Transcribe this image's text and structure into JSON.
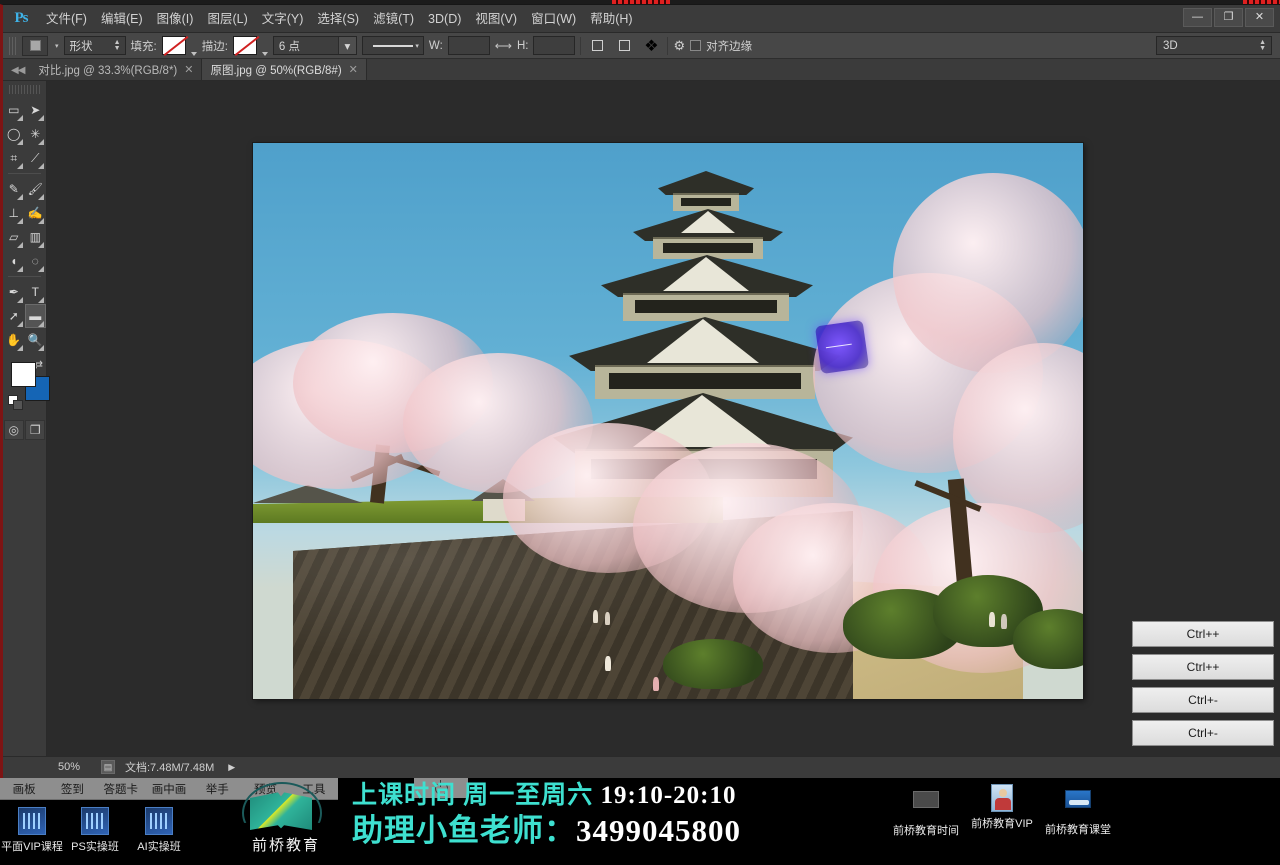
{
  "app": {
    "logo": "Ps",
    "title": "Adobe Photoshop"
  },
  "menubar": {
    "items": [
      "文件(F)",
      "编辑(E)",
      "图像(I)",
      "图层(L)",
      "文字(Y)",
      "选择(S)",
      "滤镜(T)",
      "3D(D)",
      "视图(V)",
      "窗口(W)",
      "帮助(H)"
    ]
  },
  "window_controls": {
    "minimize": "—",
    "maximize": "❐",
    "close": "✕"
  },
  "options_bar": {
    "tool_preset_icon": "shape-tool-icon",
    "mode_select": "形状",
    "fill_label": "填充:",
    "stroke_label": "描边:",
    "stroke_width": "6 点",
    "stroke_style_icon": "solid-line-icon",
    "width_label": "W:",
    "width_value": "",
    "link_icon": "link-icon",
    "height_label": "H:",
    "height_value": "",
    "path_ops_icon": "path-operations-icon",
    "path_align_icon": "path-align-icon",
    "path_arrange_icon": "path-arrange-icon",
    "settings_icon": "gear-icon",
    "align_edges_label": "对齐边缘",
    "align_edges_checked": false,
    "workspace": "3D"
  },
  "tabs": {
    "collapse_icon": "collapse-panel-icon",
    "items": [
      {
        "label": "对比.jpg @ 33.3%(RGB/8*)",
        "active": false,
        "close": "✕"
      },
      {
        "label": "原图.jpg @ 50%(RGB/8#)",
        "active": true,
        "close": "✕"
      }
    ]
  },
  "tools": {
    "rows": [
      {
        "left": {
          "name": "rectangular-marquee-tool",
          "glyph": "▭"
        },
        "right": {
          "name": "move-tool",
          "glyph": "➤"
        }
      },
      {
        "left": {
          "name": "lasso-tool",
          "glyph": "◯"
        },
        "right": {
          "name": "magic-wand-tool",
          "glyph": "✳"
        }
      },
      {
        "left": {
          "name": "crop-tool",
          "glyph": "⌗"
        },
        "right": {
          "name": "eyedropper-tool",
          "glyph": "⟋"
        }
      },
      {
        "left": {
          "name": "spot-healing-brush-tool",
          "glyph": "✎"
        },
        "right": {
          "name": "brush-tool",
          "glyph": "🖌"
        }
      },
      {
        "left": {
          "name": "clone-stamp-tool",
          "glyph": "⊥"
        },
        "right": {
          "name": "history-brush-tool",
          "glyph": "✍"
        }
      },
      {
        "left": {
          "name": "eraser-tool",
          "glyph": "▱"
        },
        "right": {
          "name": "gradient-tool",
          "glyph": "▥"
        }
      },
      {
        "left": {
          "name": "blur-tool",
          "glyph": "💧"
        },
        "right": {
          "name": "dodge-tool",
          "glyph": "✋"
        }
      },
      {
        "left": {
          "name": "pen-tool",
          "glyph": "✒"
        },
        "right": {
          "name": "type-tool",
          "glyph": "T"
        }
      },
      {
        "left": {
          "name": "path-selection-tool",
          "glyph": "➚"
        },
        "right": {
          "name": "rectangle-shape-tool",
          "glyph": "▬",
          "selected": true
        }
      },
      {
        "left": {
          "name": "hand-tool",
          "glyph": "✋"
        },
        "right": {
          "name": "zoom-tool",
          "glyph": "🔍"
        }
      }
    ],
    "foreground_color": "#ffffff",
    "background_color": "#1565b5",
    "swap_icon": "swap-colors-icon",
    "default_colors_icon": "default-colors-icon",
    "quick_mask_icon": "quick-mask-icon",
    "screen_mode_icon": "screen-mode-icon"
  },
  "canvas": {
    "document_name": "原图.jpg",
    "image_subject": "Kumamoto Castle with cherry blossoms",
    "vector_shape": {
      "name": "blue-vector-shape",
      "color": "#5a3ce0"
    }
  },
  "side_buttons": {
    "items": [
      "Ctrl++",
      "Ctrl++",
      "Ctrl+-",
      "Ctrl+-"
    ]
  },
  "statusbar": {
    "zoom": "50%",
    "thumb_icon": "document-icon",
    "doc_info": "文档:7.48M/7.48M",
    "expand_icon": "▶"
  },
  "desktop": {
    "flyout_menu": [
      "画板",
      "签到",
      "答题卡",
      "画中画",
      "举手",
      "预览",
      "工具"
    ],
    "power_icon": "power-icon",
    "shortcuts": [
      {
        "label": "平面VIP课程",
        "icon": "folder-blue-icon"
      },
      {
        "label": "PS实操班",
        "icon": "folder-blue-icon"
      },
      {
        "label": "AI实操班",
        "icon": "folder-blue-icon"
      }
    ],
    "brand": {
      "logo_icon": "qianqiao-book-logo",
      "name": "前桥教育"
    },
    "promo": {
      "line1_prefix": "上课时间 周一至周六 ",
      "line1_number": "19:10-20:10",
      "line2_prefix": "助理小鱼老师：",
      "line2_number": "3499045800",
      "accent_color": "#3ee0d0",
      "number_color": "#ffffff"
    },
    "tray": [
      {
        "label": "前桥教育时间",
        "icon": "dark-window-icon"
      },
      {
        "label": "前桥教育VIP",
        "icon": "person-photo-icon"
      },
      {
        "label": "前桥教育课堂",
        "icon": "blue-flag-icon"
      }
    ]
  }
}
